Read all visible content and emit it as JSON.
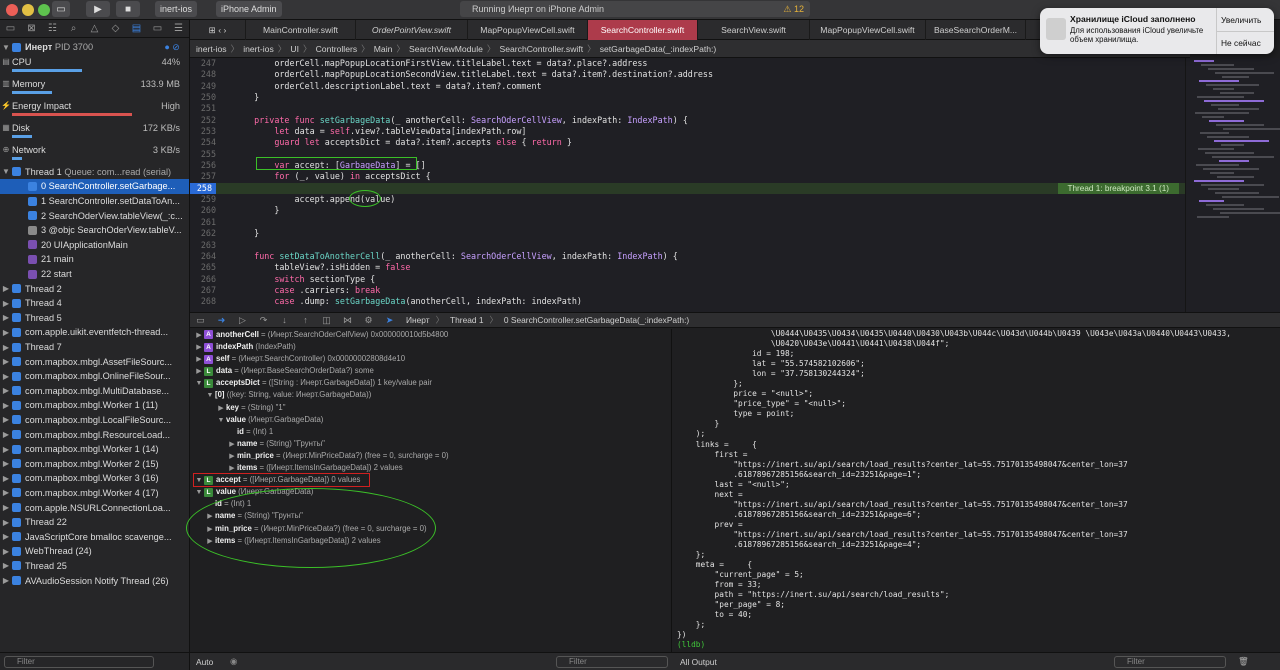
{
  "toolbar": {
    "scheme": "inert-ios",
    "device": "iPhone Admin",
    "status": "Running Инерт on iPhone Admin",
    "warnings": "12"
  },
  "notification": {
    "title": "Хранилище iCloud заполнено",
    "body": "Для использования iCloud увеличьте объем хранилища.",
    "primary": "Увеличить",
    "secondary": "Не сейчас"
  },
  "navigator": {
    "process": "Инерт",
    "pid": "PID 3700",
    "gauges": [
      {
        "label": "CPU",
        "value": "44%"
      },
      {
        "label": "Memory",
        "value": "133.9 MB"
      },
      {
        "label": "Energy Impact",
        "value": "High"
      },
      {
        "label": "Disk",
        "value": "172 KB/s"
      },
      {
        "label": "Network",
        "value": "3 KB/s"
      }
    ],
    "thread1": "Thread 1",
    "thread1_queue": "Queue: com...read (serial)",
    "frames": [
      "0 SearchController.setGarbage...",
      "1 SearchController.setDataToAn...",
      "2 SearchOderView.tableView(_:c...",
      "3 @objc SearchOderView.tableV...",
      "20 UIApplicationMain",
      "21 main",
      "22 start"
    ],
    "threads": [
      "Thread 2",
      "Thread 4",
      "Thread 5",
      "com.apple.uikit.eventfetch-thread...",
      "Thread 7",
      "com.mapbox.mbgl.AssetFileSourc...",
      "com.mapbox.mbgl.OnlineFileSour...",
      "com.mapbox.mbgl.MultiDatabase...",
      "com.mapbox.mbgl.Worker 1 (11)",
      "com.mapbox.mbgl.LocalFileSourc...",
      "com.mapbox.mbgl.ResourceLoad...",
      "com.mapbox.mbgl.Worker 1 (14)",
      "com.mapbox.mbgl.Worker 2 (15)",
      "com.mapbox.mbgl.Worker 3 (16)",
      "com.mapbox.mbgl.Worker 4 (17)",
      "com.apple.NSURLConnectionLoa...",
      "Thread 22",
      "JavaScriptCore bmalloc scavenge...",
      "WebThread (24)",
      "Thread 25",
      "AVAudioSession Notify Thread (26)"
    ],
    "filter_placeholder": "Filter"
  },
  "tabs": [
    {
      "label": "MainController.swift"
    },
    {
      "label": "OrderPointView.swift"
    },
    {
      "label": "MapPopupViewCell.swift"
    },
    {
      "label": "SearchController.swift"
    },
    {
      "label": "SearchView.swift"
    },
    {
      "label": "MapPopupViewCell.swift"
    },
    {
      "label": "BaseSearchOrderM..."
    }
  ],
  "breadcrumb": [
    "inert-ios",
    "inert-ios",
    "UI",
    "Controllers",
    "Main",
    "SearchViewModule",
    "SearchController.swift",
    "setGarbageData(_:indexPath:)"
  ],
  "code": [
    {
      "n": "247",
      "t": "        orderCell.mapPopupLocationFirstView.titleLabel.text = data?.place?.address"
    },
    {
      "n": "248",
      "t": "        orderCell.mapPopupLocationSecondView.titleLabel.text = data?.item?.destination?.address"
    },
    {
      "n": "249",
      "t": "        orderCell.descriptionLabel.text = data?.item?.comment"
    },
    {
      "n": "250",
      "t": "    }"
    },
    {
      "n": "251",
      "t": ""
    },
    {
      "n": "252",
      "t": "    private func setGarbageData(_ anotherCell: SearchOderCellView, indexPath: IndexPath) {"
    },
    {
      "n": "253",
      "t": "        let data = self.view?.tableViewData[indexPath.row]"
    },
    {
      "n": "254",
      "t": "        guard let acceptsDict = data?.item?.accepts else { return }"
    },
    {
      "n": "255",
      "t": ""
    },
    {
      "n": "256",
      "t": "        var accept: [GarbageData] = []"
    },
    {
      "n": "257",
      "t": "        for (_, value) in acceptsDict {"
    },
    {
      "n": "258",
      "t": ""
    },
    {
      "n": "259",
      "t": "            accept.append(value)"
    },
    {
      "n": "260",
      "t": "        }"
    },
    {
      "n": "261",
      "t": ""
    },
    {
      "n": "262",
      "t": "    }"
    },
    {
      "n": "263",
      "t": ""
    },
    {
      "n": "264",
      "t": "    func setDataToAnotherCell(_ anotherCell: SearchOderCellView, indexPath: IndexPath) {"
    },
    {
      "n": "265",
      "t": "        tableView?.isHidden = false"
    },
    {
      "n": "266",
      "t": "        switch sectionType {"
    },
    {
      "n": "267",
      "t": "        case .carriers: break"
    },
    {
      "n": "268",
      "t": "        case .dump: setGarbageData(anotherCell, indexPath: indexPath)"
    }
  ],
  "breakpoint_label": "Thread 1: breakpoint 3.1 (1)",
  "debugbar": {
    "target": "Инерт",
    "thread": "Thread 1",
    "frame": "0 SearchController.setGarbageData(_:indexPath:)"
  },
  "variables": [
    {
      "d": 0,
      "tri": "▶",
      "b": "A",
      "bc": "#8e4fd6",
      "name": "anotherCell",
      "rest": " = (Инерт.SearchOderCellView) 0x000000010d5b4800"
    },
    {
      "d": 0,
      "tri": "▶",
      "b": "A",
      "bc": "#8e4fd6",
      "name": "indexPath",
      "rest": " (IndexPath)"
    },
    {
      "d": 0,
      "tri": "▶",
      "b": "A",
      "bc": "#8e4fd6",
      "name": "self",
      "rest": " = (Инерт.SearchController) 0x00000002808d4e10"
    },
    {
      "d": 0,
      "tri": "▶",
      "b": "L",
      "bc": "#3a8a3a",
      "name": "data",
      "rest": " = (Инерт.BaseSearchOrderData?) some"
    },
    {
      "d": 0,
      "tri": "▼",
      "b": "L",
      "bc": "#3a8a3a",
      "name": "acceptsDict",
      "rest": " = ([String : Инерт.GarbageData]) 1 key/value pair"
    },
    {
      "d": 1,
      "tri": "▼",
      "b": "",
      "bc": "",
      "name": "[0]",
      "rest": " ((key: String, value: Инерт.GarbageData))"
    },
    {
      "d": 2,
      "tri": "▶",
      "b": "",
      "bc": "",
      "name": "key",
      "rest": " = (String) \"1\""
    },
    {
      "d": 2,
      "tri": "▼",
      "b": "",
      "bc": "",
      "name": "value",
      "rest": " (Инерт.GarbageData)"
    },
    {
      "d": 3,
      "tri": "",
      "b": "",
      "bc": "",
      "name": "id",
      "rest": " = (Int) 1"
    },
    {
      "d": 3,
      "tri": "▶",
      "b": "",
      "bc": "",
      "name": "name",
      "rest": " = (String) \"Грунты\""
    },
    {
      "d": 3,
      "tri": "▶",
      "b": "",
      "bc": "",
      "name": "min_price",
      "rest": " = (Инерт.MinPriceData?) (free = 0, surcharge = 0)"
    },
    {
      "d": 3,
      "tri": "▶",
      "b": "",
      "bc": "",
      "name": "items",
      "rest": " = ([Инерт.ItemsInGarbageData]) 2 values"
    },
    {
      "d": 0,
      "tri": "▼",
      "b": "L",
      "bc": "#3a8a3a",
      "name": "accept",
      "rest": " = ([Инерт.GarbageData]) 0 values"
    },
    {
      "d": 0,
      "tri": "▼",
      "b": "L",
      "bc": "#3a8a3a",
      "name": "value",
      "rest": " (Инерт.GarbageData)"
    },
    {
      "d": 1,
      "tri": "",
      "b": "",
      "bc": "",
      "name": "id",
      "rest": " = (Int) 1"
    },
    {
      "d": 1,
      "tri": "▶",
      "b": "",
      "bc": "",
      "name": "name",
      "rest": " = (String) \"Грунты\""
    },
    {
      "d": 1,
      "tri": "▶",
      "b": "",
      "bc": "",
      "name": "min_price",
      "rest": " = (Инерт.MinPriceData?) (free = 0, surcharge = 0)"
    },
    {
      "d": 1,
      "tri": "▶",
      "b": "",
      "bc": "",
      "name": "items",
      "rest": " = ([Инерт.ItemsInGarbageData]) 2 values"
    }
  ],
  "console": [
    "                    \\U0444\\U0435\\U0434\\U0435\\U0440\\U0430\\U043b\\U044c\\U043d\\U044b\\U0439 \\U043e\\U043a\\U0440\\U0443\\U0433,",
    "                    \\U0420\\U043e\\U0441\\U0441\\U0438\\U044f\";",
    "                id = 198;",
    "                lat = \"55.574582102606\";",
    "                lon = \"37.758130244324\";",
    "            };",
    "            price = \"<null>\";",
    "            \"price_type\" = \"<null>\";",
    "            type = point;",
    "        }",
    "    );",
    "    links =     {",
    "        first =",
    "            \"https://inert.su/api/search/load_results?center_lat=55.75170135498047&center_lon=37",
    "            .61878967285156&search_id=23251&page=1\";",
    "        last = \"<null>\";",
    "        next =",
    "            \"https://inert.su/api/search/load_results?center_lat=55.75170135498047&center_lon=37",
    "            .61878967285156&search_id=23251&page=6\";",
    "        prev =",
    "            \"https://inert.su/api/search/load_results?center_lat=55.75170135498047&center_lon=37",
    "            .61878967285156&search_id=23251&page=4\";",
    "    };",
    "    meta =     {",
    "        \"current_page\" = 5;",
    "        from = 33;",
    "        path = \"https://inert.su/api/search/load_results\";",
    "        \"per_page\" = 8;",
    "        to = 40;",
    "    };",
    "})",
    "(lldb)"
  ],
  "bottom": {
    "auto": "Auto",
    "filter": "Filter",
    "output": "All Output"
  },
  "colors": {
    "breakpoint": "#2a6ad6",
    "active_tab": "#ad3b4b",
    "selection": "#1e5eb8",
    "annotation": "#3bbf28",
    "highlight_red": "#d02020"
  }
}
